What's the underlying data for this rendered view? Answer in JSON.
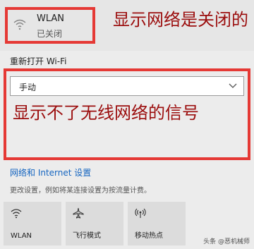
{
  "wlan": {
    "name": "WLAN",
    "status": "已关闭",
    "icon": "wifi-off-icon"
  },
  "reconnect": {
    "label": "重新打开 Wi-Fi",
    "dropdown_value": "手动"
  },
  "annotations": {
    "top": "显示网络是关闭的",
    "main": "显示不了无线网络的信号",
    "color": "#9b0d0d",
    "box_color": "#e53935"
  },
  "settings": {
    "link": "网络和 Internet 设置",
    "description": "更改设置，例如将某连接设置为按流量计费。"
  },
  "tiles": [
    {
      "label": "WLAN",
      "icon": "wifi-icon"
    },
    {
      "label": "飞行模式",
      "icon": "airplane-icon"
    },
    {
      "label": "移动热点",
      "icon": "hotspot-icon"
    }
  ],
  "watermark": "头条 @恶机械师"
}
